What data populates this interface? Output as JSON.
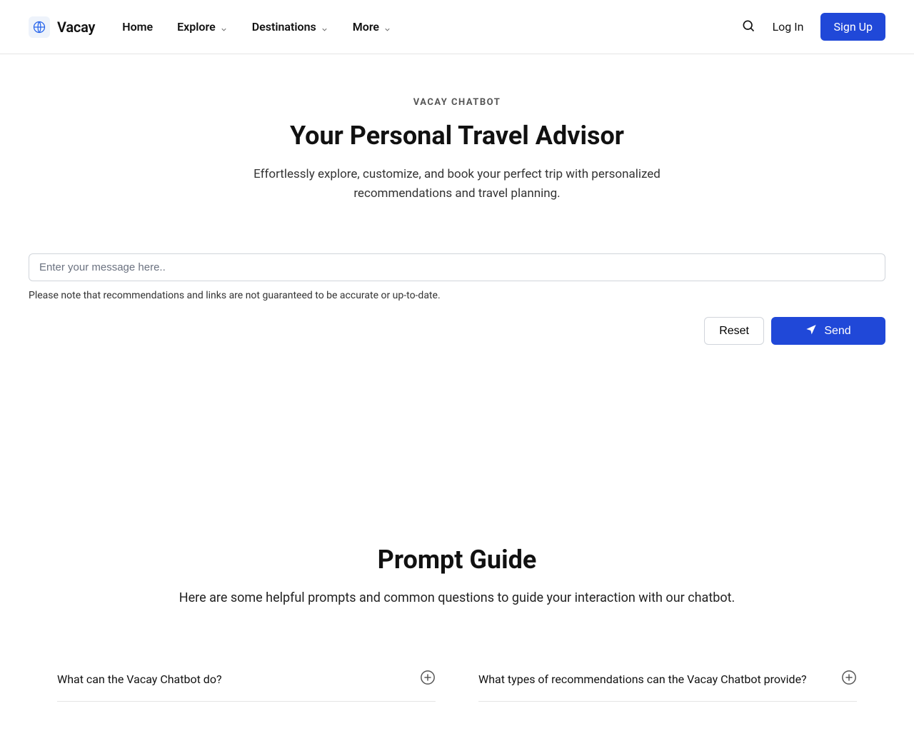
{
  "brand": "Vacay",
  "nav": {
    "home": "Home",
    "explore": "Explore",
    "destinations": "Destinations",
    "more": "More"
  },
  "auth": {
    "login": "Log In",
    "signup": "Sign Up"
  },
  "hero": {
    "eyebrow": "VACAY CHATBOT",
    "title": "Your Personal Travel Advisor",
    "subtitle": "Effortlessly explore, customize, and book your perfect trip with personalized recommendations and travel planning."
  },
  "chat": {
    "placeholder": "Enter your message here..",
    "disclaimer": "Please note that recommendations and links are not guaranteed to be accurate or up-to-date.",
    "reset": "Reset",
    "send": "Send"
  },
  "guide": {
    "title": "Prompt Guide",
    "subtitle": "Here are some helpful prompts and common questions to guide your interaction with our chatbot."
  },
  "faqs": [
    "What can the Vacay Chatbot do?",
    "What types of recommendations can the Vacay Chatbot provide?"
  ]
}
